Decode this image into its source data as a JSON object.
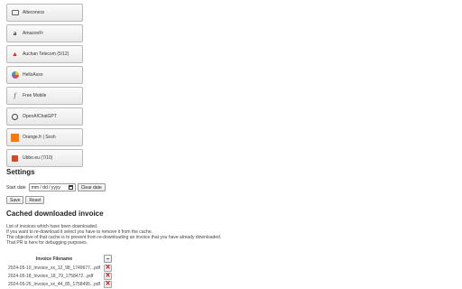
{
  "providers": [
    {
      "label": "Alteconess",
      "icon": "window-icon"
    },
    {
      "label": "AmazonFr",
      "icon": "amazon-icon"
    },
    {
      "label": "Auchan Telecom (5/12)",
      "icon": "auchan-icon"
    },
    {
      "label": "HelloAsso",
      "icon": "helloasso-icon"
    },
    {
      "label": "Free Mobile",
      "icon": "free-icon"
    },
    {
      "label": "OpenAIChatGPT",
      "icon": "openai-icon"
    },
    {
      "label": "Orange.fr | Sosh",
      "icon": "orange-icon"
    },
    {
      "label": "Ubbo.eu (7/10)",
      "icon": "ubbo-icon"
    }
  ],
  "settings": {
    "title": "Settings",
    "start_date_label": "Start date",
    "start_date_value": "mm / dd / yyyy",
    "clear_label": "Clear date",
    "save_label": "Save",
    "reset_label": "Reset"
  },
  "cache": {
    "title": "Cached downloaded invoice",
    "desc": [
      "List of invoices which have been downloaded.",
      "If you want to re-download it select you have to remove it from the cache.",
      "The objective of that cache is to prevent from re-downloading an invoice that you have already downloaded.",
      "That PR is here for debugging purposes."
    ],
    "column_header": "Invoice Filename",
    "rows": [
      "2024-05-10_Invoice_xx_12_98_1749677...pdf",
      "2024-05-18_Invoice_18_79_1758472...pdf",
      "2024-05-25_Invoice_xx_44_85_1758495...pdf"
    ]
  },
  "colors": {
    "delete": "#d00000",
    "orange": "#ff7900"
  }
}
